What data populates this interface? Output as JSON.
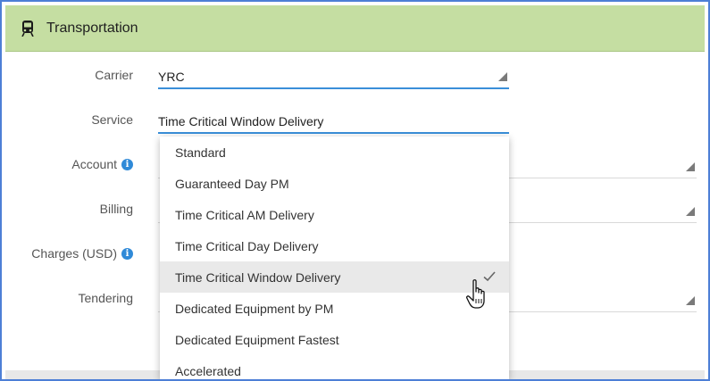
{
  "panel": {
    "title": "Transportation",
    "icon": "train-icon",
    "header_color": "#c5dea2"
  },
  "form": {
    "carrier": {
      "label": "Carrier",
      "value": "YRC"
    },
    "service": {
      "label": "Service",
      "value": "Time Critical Window Delivery"
    },
    "account": {
      "label": "Account",
      "value": ""
    },
    "billing": {
      "label": "Billing",
      "value": ""
    },
    "charges": {
      "label": "Charges (USD)",
      "value": ""
    },
    "tendering": {
      "label": "Tendering",
      "value": ""
    }
  },
  "dropdown": {
    "options": [
      "Standard",
      "Guaranteed Day PM",
      "Time Critical AM Delivery",
      "Time Critical Day Delivery",
      "Time Critical Window Delivery",
      "Dedicated Equipment by PM",
      "Dedicated Equipment Fastest",
      "Accelerated"
    ],
    "selected_index": 4
  },
  "colors": {
    "accent": "#3a8fd9",
    "frame": "#4d7fd6",
    "info": "#2f8ad8"
  }
}
